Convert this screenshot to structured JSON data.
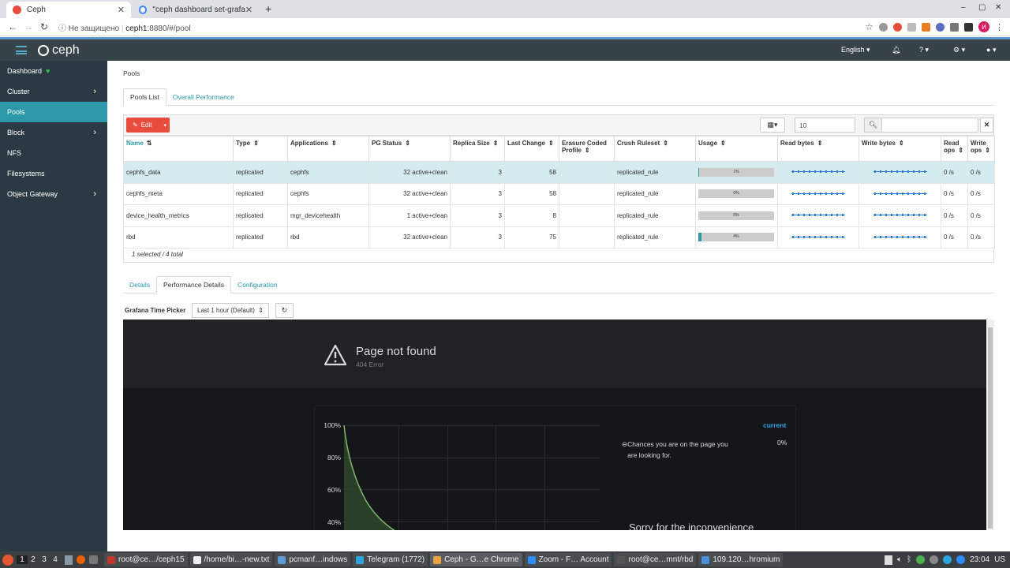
{
  "browser": {
    "tabs": [
      {
        "title": "Ceph",
        "active": true
      },
      {
        "title": "\"ceph dashboard set-grafa",
        "active": false
      }
    ],
    "new_tab": "+",
    "window_controls": [
      "‒",
      "▢",
      "✕"
    ],
    "security_label": "Не защищено",
    "url_host": "ceph1",
    "url_rest": ":8880/#/pool",
    "avatar_letter": "И"
  },
  "topnav": {
    "brand": "ceph",
    "language": "English",
    "help_icon": "?",
    "accent": "#2b99a8"
  },
  "sidebar": {
    "items": [
      {
        "label": "Dashboard",
        "has_children": false,
        "active": false
      },
      {
        "label": "Cluster",
        "has_children": true,
        "active": false
      },
      {
        "label": "Pools",
        "has_children": false,
        "active": true
      },
      {
        "label": "Block",
        "has_children": true,
        "active": false
      },
      {
        "label": "NFS",
        "has_children": false,
        "active": false
      },
      {
        "label": "Filesystems",
        "has_children": false,
        "active": false
      },
      {
        "label": "Object Gateway",
        "has_children": true,
        "active": false
      }
    ]
  },
  "breadcrumb": "Pools",
  "main_tabs": [
    {
      "label": "Pools List",
      "active": true
    },
    {
      "label": "Overall Performance",
      "active": false
    }
  ],
  "toolbar": {
    "edit_label": "Edit",
    "limit_value": "10",
    "search_value": ""
  },
  "table": {
    "columns": [
      "Name",
      "Type",
      "Applications",
      "PG Status",
      "Replica Size",
      "Last Change",
      "Erasure Coded Profile",
      "Crush Ruleset",
      "Usage",
      "Read bytes",
      "Write bytes",
      "Read ops",
      "Write ops"
    ],
    "rows": [
      {
        "name": "cephfs_data",
        "type": "replicated",
        "applications": "cephfs",
        "pg_status": "32 active+clean",
        "replica_size": "3",
        "last_change": "58",
        "ec_profile": "",
        "crush": "replicated_rule",
        "usage_label": "1%",
        "usage": 0.01,
        "read_ops": "0 /s",
        "write_ops": "0 /s",
        "selected": true
      },
      {
        "name": "cephfs_meta",
        "type": "replicated",
        "applications": "cephfs",
        "pg_status": "32 active+clean",
        "replica_size": "3",
        "last_change": "58",
        "ec_profile": "",
        "crush": "replicated_rule",
        "usage_label": "0%",
        "usage": 0.0,
        "read_ops": "0 /s",
        "write_ops": "0 /s",
        "selected": false
      },
      {
        "name": "device_health_metrics",
        "type": "replicated",
        "applications": "mgr_devicehealth",
        "pg_status": "1 active+clean",
        "replica_size": "3",
        "last_change": "8",
        "ec_profile": "",
        "crush": "replicated_rule",
        "usage_label": "0%",
        "usage": 0.0,
        "read_ops": "0 /s",
        "write_ops": "0 /s",
        "selected": false
      },
      {
        "name": "rbd",
        "type": "replicated",
        "applications": "rbd",
        "pg_status": "32 active+clean",
        "replica_size": "3",
        "last_change": "75",
        "ec_profile": "",
        "crush": "replicated_rule",
        "usage_label": "4%",
        "usage": 0.04,
        "read_ops": "0 /s",
        "write_ops": "0 /s",
        "selected": false
      }
    ],
    "footer": "1 selected / 4 total"
  },
  "detail_tabs": [
    {
      "label": "Details",
      "active": false
    },
    {
      "label": "Performance Details",
      "active": true
    },
    {
      "label": "Configuration",
      "active": false
    }
  ],
  "grafana_picker": {
    "label": "Grafana Time Picker",
    "value": "Last 1 hour (Default)"
  },
  "grafana": {
    "title": "Page not found",
    "subtitle": "404 Error",
    "y_ticks": [
      "100%",
      "80%",
      "60%",
      "40%"
    ],
    "legend_header": "current",
    "legend_item": "Chances you are on the page you are looking for.",
    "legend_value": "0%",
    "sorry": "Sorry for the inconvenience"
  },
  "taskbar": {
    "workspaces": [
      "1",
      "2",
      "3",
      "4"
    ],
    "apps": [
      {
        "label": "root@ce…/ceph15",
        "color": "#c0392b"
      },
      {
        "label": "/home/bi…-new.txt",
        "color": "#ecf0f1"
      },
      {
        "label": "pcmanf…indows",
        "color": "#5b9bd5"
      },
      {
        "label": "Telegram (1772)",
        "color": "#2ca5e0"
      },
      {
        "label": "Ceph - G…e Chrome",
        "color": "#e8a33d"
      },
      {
        "label": "Zoom - F… Account",
        "color": "#2d8cff"
      },
      {
        "label": "root@ce…mnt/rbd",
        "color": "#555"
      },
      {
        "label": "109.120…hromium",
        "color": "#4a90d9"
      }
    ],
    "clock": "23:04",
    "layout": "US"
  }
}
